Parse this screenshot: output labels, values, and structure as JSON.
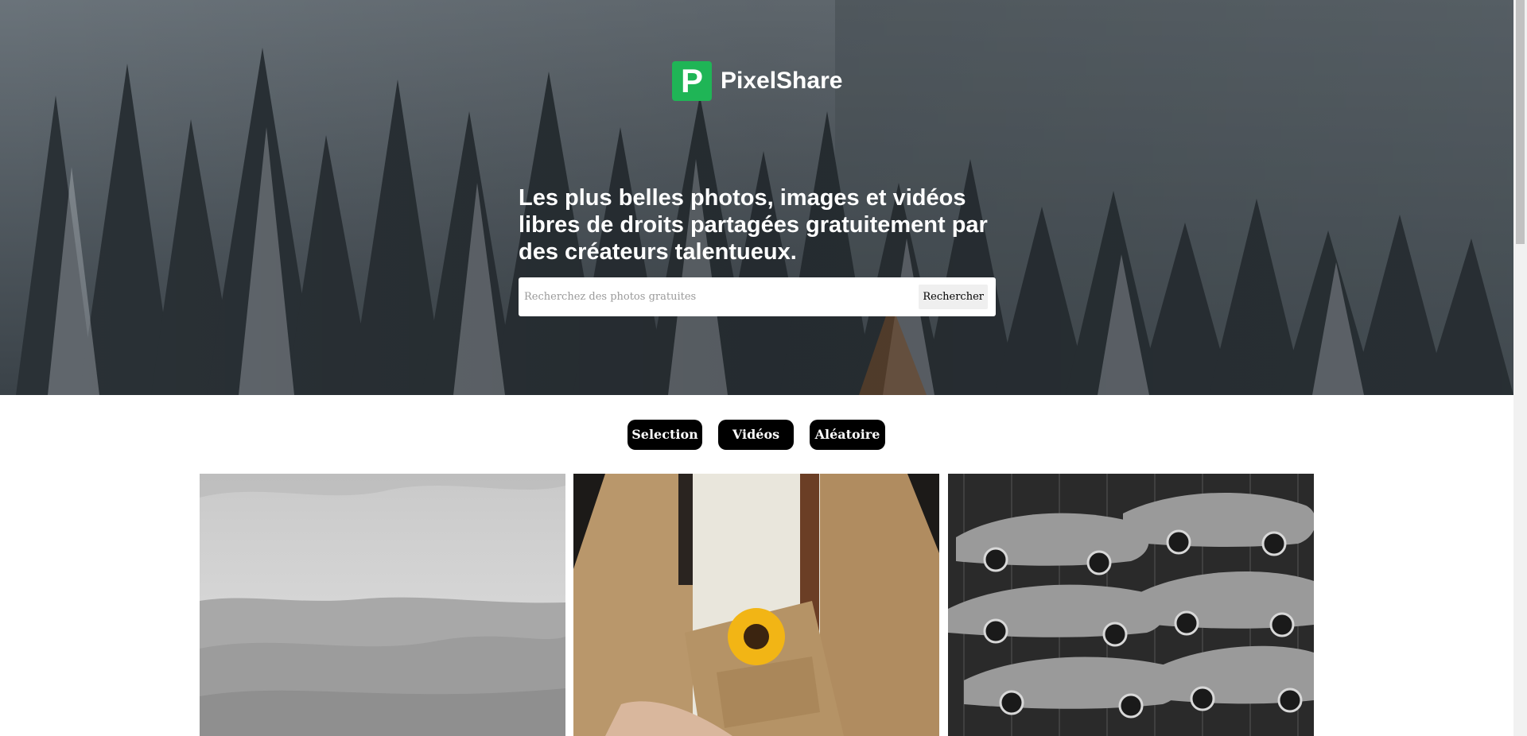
{
  "brand": {
    "logo_letter": "P",
    "name": "PixelShare",
    "accent_color": "#1fb556"
  },
  "hero": {
    "headline": "Les plus belles photos, images et vidéos libres de droits partagées gratuitement par des créateurs talentueux.",
    "search_placeholder": "Recherchez des photos gratuites",
    "search_button": "Rechercher"
  },
  "tabs": [
    {
      "label": "Selection"
    },
    {
      "label": "Vidéos"
    },
    {
      "label": "Aléatoire"
    }
  ],
  "photos": [
    {
      "subject": "grayscale mountain landscape under cloudy sky"
    },
    {
      "subject": "person in beige coat holding a sunflower bouquet"
    },
    {
      "subject": "black and white suspended sculptures of cars"
    }
  ],
  "icons": [
    "pixelshare-logo-icon"
  ]
}
